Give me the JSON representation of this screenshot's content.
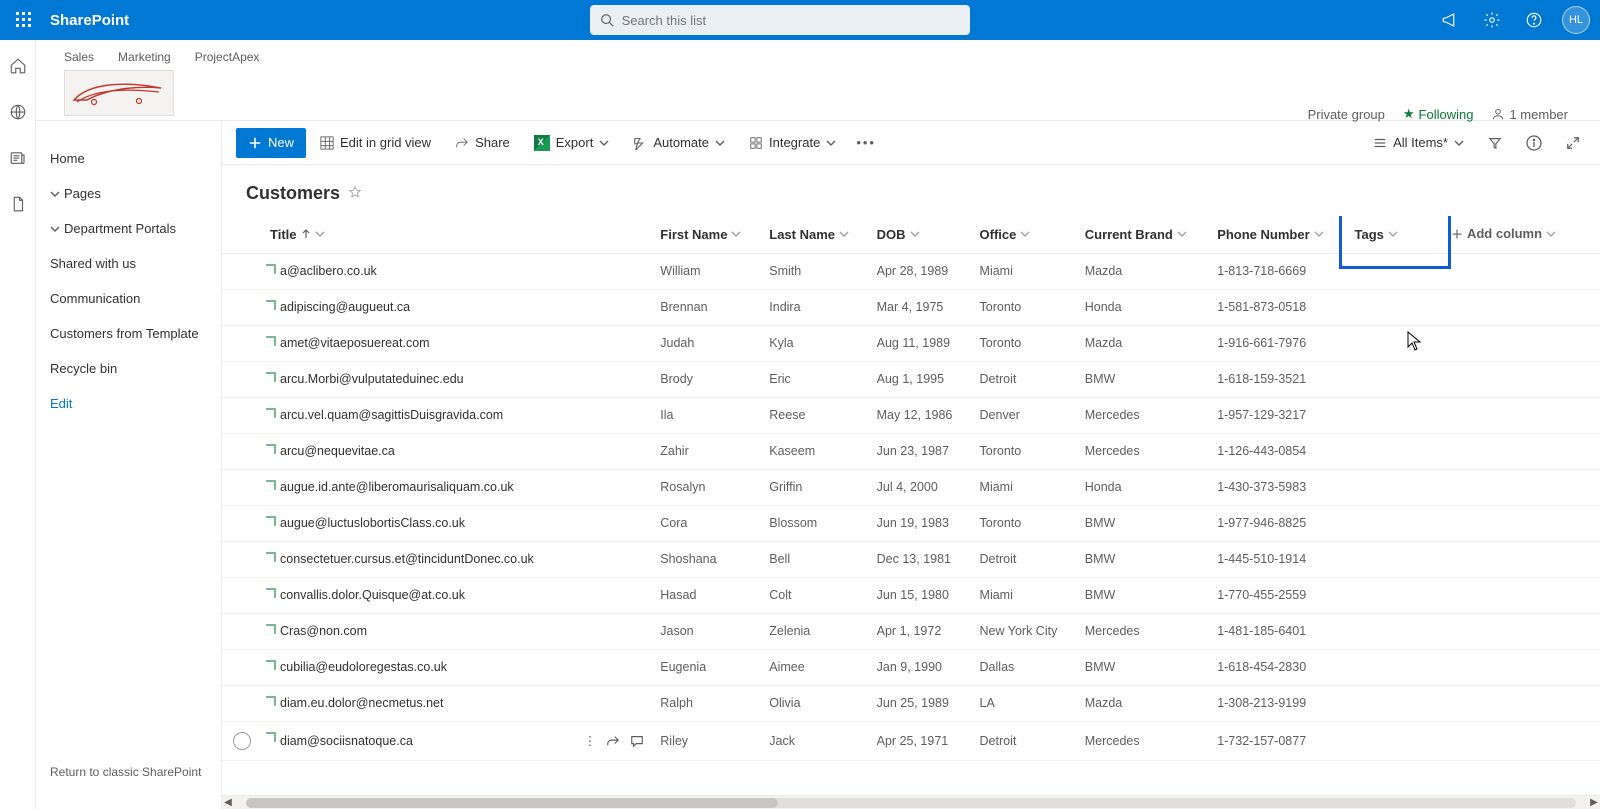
{
  "suite": {
    "app_name": "SharePoint",
    "search_placeholder": "Search this list",
    "avatar_initials": "HL"
  },
  "hub_links": [
    "Sales",
    "Marketing",
    "ProjectApex"
  ],
  "site_info": {
    "privacy": "Private group",
    "following_label": "Following",
    "members_label": "1 member"
  },
  "left_nav": {
    "home": "Home",
    "pages": "Pages",
    "dept": "Department Portals",
    "shared": "Shared with us",
    "comm": "Communication",
    "cft": "Customers from Template",
    "recycle": "Recycle bin",
    "edit": "Edit",
    "return": "Return to classic SharePoint"
  },
  "cmd": {
    "new": "New",
    "edit_grid": "Edit in grid view",
    "share": "Share",
    "export": "Export",
    "automate": "Automate",
    "integrate": "Integrate",
    "all_items": "All Items*"
  },
  "list": {
    "title": "Customers"
  },
  "columns": {
    "title": "Title",
    "first": "First Name",
    "last": "Last Name",
    "dob": "DOB",
    "office": "Office",
    "brand": "Current Brand",
    "phone": "Phone Number",
    "tags": "Tags",
    "add": "Add column"
  },
  "rows": [
    {
      "title": "a@aclibero.co.uk",
      "first": "William",
      "last": "Smith",
      "dob": "Apr 28, 1989",
      "office": "Miami",
      "brand": "Mazda",
      "phone": "1-813-718-6669"
    },
    {
      "title": "adipiscing@augueut.ca",
      "first": "Brennan",
      "last": "Indira",
      "dob": "Mar 4, 1975",
      "office": "Toronto",
      "brand": "Honda",
      "phone": "1-581-873-0518"
    },
    {
      "title": "amet@vitaeposuereat.com",
      "first": "Judah",
      "last": "Kyla",
      "dob": "Aug 11, 1989",
      "office": "Toronto",
      "brand": "Mazda",
      "phone": "1-916-661-7976"
    },
    {
      "title": "arcu.Morbi@vulputateduinec.edu",
      "first": "Brody",
      "last": "Eric",
      "dob": "Aug 1, 1995",
      "office": "Detroit",
      "brand": "BMW",
      "phone": "1-618-159-3521"
    },
    {
      "title": "arcu.vel.quam@sagittisDuisgravida.com",
      "first": "Ila",
      "last": "Reese",
      "dob": "May 12, 1986",
      "office": "Denver",
      "brand": "Mercedes",
      "phone": "1-957-129-3217"
    },
    {
      "title": "arcu@nequevitae.ca",
      "first": "Zahir",
      "last": "Kaseem",
      "dob": "Jun 23, 1987",
      "office": "Toronto",
      "brand": "Mercedes",
      "phone": "1-126-443-0854"
    },
    {
      "title": "augue.id.ante@liberomaurisaliquam.co.uk",
      "first": "Rosalyn",
      "last": "Griffin",
      "dob": "Jul 4, 2000",
      "office": "Miami",
      "brand": "Honda",
      "phone": "1-430-373-5983"
    },
    {
      "title": "augue@luctuslobortisClass.co.uk",
      "first": "Cora",
      "last": "Blossom",
      "dob": "Jun 19, 1983",
      "office": "Toronto",
      "brand": "BMW",
      "phone": "1-977-946-8825"
    },
    {
      "title": "consectetuer.cursus.et@tinciduntDonec.co.uk",
      "first": "Shoshana",
      "last": "Bell",
      "dob": "Dec 13, 1981",
      "office": "Detroit",
      "brand": "BMW",
      "phone": "1-445-510-1914"
    },
    {
      "title": "convallis.dolor.Quisque@at.co.uk",
      "first": "Hasad",
      "last": "Colt",
      "dob": "Jun 15, 1980",
      "office": "Miami",
      "brand": "BMW",
      "phone": "1-770-455-2559"
    },
    {
      "title": "Cras@non.com",
      "first": "Jason",
      "last": "Zelenia",
      "dob": "Apr 1, 1972",
      "office": "New York City",
      "brand": "Mercedes",
      "phone": "1-481-185-6401"
    },
    {
      "title": "cubilia@eudoloregestas.co.uk",
      "first": "Eugenia",
      "last": "Aimee",
      "dob": "Jan 9, 1990",
      "office": "Dallas",
      "brand": "BMW",
      "phone": "1-618-454-2830"
    },
    {
      "title": "diam.eu.dolor@necmetus.net",
      "first": "Ralph",
      "last": "Olivia",
      "dob": "Jun 25, 1989",
      "office": "LA",
      "brand": "Mazda",
      "phone": "1-308-213-9199"
    },
    {
      "title": "diam@sociisnatoque.ca",
      "first": "Riley",
      "last": "Jack",
      "dob": "Apr 25, 1971",
      "office": "Detroit",
      "brand": "Mercedes",
      "phone": "1-732-157-0877"
    }
  ]
}
